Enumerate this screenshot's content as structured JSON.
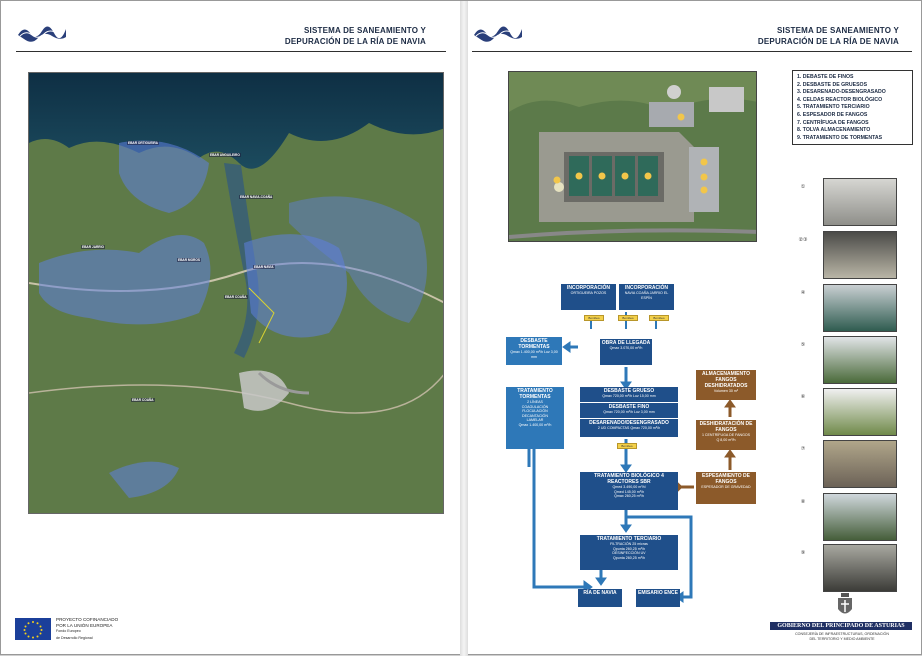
{
  "left_page": {
    "header_line1": "SISTEMA DE SANEAMIENTO Y",
    "header_line2": "DEPURACIÓN DE LA RÍA DE NAVIA",
    "eu": {
      "line1": "PROYECTO COFINANCIADO",
      "line2": "POR LA UNIÓN EUROPEA",
      "line3": "Fondo Europeo",
      "line4": "de Desarrollo Regional"
    }
  },
  "right_page": {
    "header_line1": "SISTEMA DE SANEAMIENTO Y",
    "header_line2": "DEPURACIÓN DE LA RÍA DE NAVIA",
    "legend": [
      "1. DEBASTE DE FINOS",
      "2. DESBASTE DE GRUESOS",
      "3. DESARENADO-DESENGRASADO",
      "4. CELDAS REACTOR BIOLÓGICO",
      "5. TRATAMIENTO TERCIARIO",
      "6. ESPESADOR DE FANGOS",
      "7. CENTRÍFUGA DE FANGOS",
      "8. TOLVA ALMACENAMIENTO",
      "9. TRATAMIENTO DE TORMENTAS"
    ],
    "photo_numbers": [
      "①",
      "②③",
      "④",
      "⑤",
      "⑥",
      "⑦",
      "⑧",
      "⑨"
    ],
    "flow": {
      "inc1_title": "INCORPORACIÓN",
      "inc1_sub": "ORTIGUEIRA\nPOZOS",
      "inc2_title": "INCORPORACIÓN",
      "inc2_sub": "NAVIA\nCOAÑA   JARRIO\nEL ESPÍN",
      "obra_title": "OBRA DE LLEGADA",
      "obra_sub": "Qmax 3.070,00 m³/h",
      "desbaste_torm_title": "DESBASTE TORMENTAS",
      "desbaste_torm_sub": "Qmax 1.400,00 m³/h   Luz 3,00 mm",
      "trat_torm_title": "TRATAMIENTO TORMENTAS",
      "trat_torm_sub": "2 LÍNEAS\nCOAGULACIÓN\nFLOCULACIÓN\nDECANTACIÓN\nLAMELAR\nQmax 1.400,00 m³/h",
      "grueso_title": "DESBASTE GRUESO",
      "grueso_sub": "Qmax 720,00 m³/h   Luz 15,00 mm",
      "fino_title": "DESBASTE FINO",
      "fino_sub": "Qmax 720,00 m³/h   Luz 3,00 mm",
      "desarenado_title": "DESARENADO/DESENGRASADO",
      "desarenado_sub": "2 UD COMPACTAS  Qmax 720,00 m³/h",
      "bio_title": "TRATAMIENTO BIOLÓGICO 4 REACTORES SBR",
      "bio_sub": "Qmed 3.490,00 m³/d\nQmed 145,00 m³/h\nQmax 260,25 m³/h",
      "terciario_title": "TRATAMIENTO TERCIARIO",
      "terciario_sub": "FILTRACIÓN 25 micras\nQpunta 260,25 m³/h\nDESINFECCIÓN UV\nQpunta 260,25 m³/h",
      "ria_title": "RÍA DE NAVIA",
      "emisario_title": "EMISARIO ENCE",
      "almacen_title": "ALMACENAMIENTO FANGOS DESHIDRATADOS",
      "almacen_sub": "Volumen 30 m³",
      "deshid_title": "DESHIDRATACIÓN DE FANGOS",
      "deshid_sub": "1 CENTRÍFUGA DE FANGOS\nQ 8,00 m³/h",
      "espes_title": "ESPESAMIENTO DE FANGOS",
      "espes_sub": "ESPESADOR DE GRAVEDAD",
      "tag_label": "Bombeo"
    },
    "gov": {
      "name": "GOBIERNO DEL PRINCIPADO DE ASTURIAS",
      "dept": "CONSEJERÍA DE INFRAESTRUCTURAS, ORDENACIÓN\nDEL TERRITORIO Y MEDIO AMBIENTE"
    }
  },
  "colors": {
    "flow_dark": "#1f4f8a",
    "flow_light": "#2e78b8",
    "sludge": "#8c5a2a",
    "header_text": "#1c2b44"
  }
}
